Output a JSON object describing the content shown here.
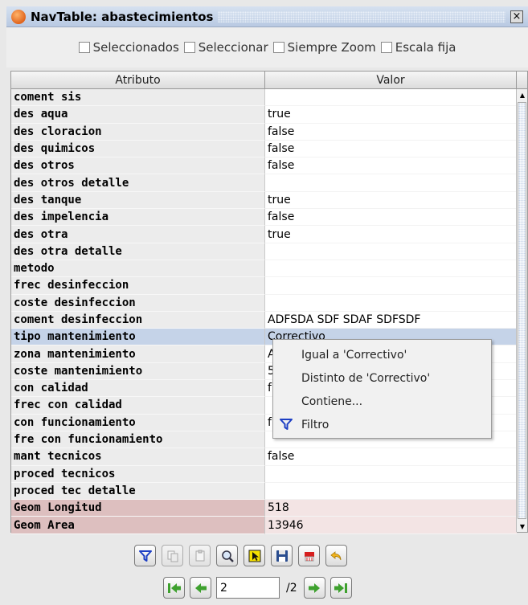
{
  "window": {
    "title": "NavTable: abastecimientos",
    "close_glyph": "×"
  },
  "options": {
    "seleccionados": "Seleccionados",
    "seleccionar": "Seleccionar",
    "siempre_zoom": "Siempre Zoom",
    "escala_fija": "Escala fija"
  },
  "table": {
    "headers": {
      "attr": "Atributo",
      "val": "Valor"
    },
    "rows": [
      {
        "attr": "coment sis",
        "val": ""
      },
      {
        "attr": "des aqua",
        "val": "true"
      },
      {
        "attr": "des cloracion",
        "val": "false"
      },
      {
        "attr": "des quimicos",
        "val": "false"
      },
      {
        "attr": "des otros",
        "val": "false"
      },
      {
        "attr": "des otros detalle",
        "val": ""
      },
      {
        "attr": "des tanque",
        "val": "true"
      },
      {
        "attr": "des impelencia",
        "val": "false"
      },
      {
        "attr": "des otra",
        "val": "true"
      },
      {
        "attr": "des otra detalle",
        "val": ""
      },
      {
        "attr": "metodo",
        "val": ""
      },
      {
        "attr": "frec desinfeccion",
        "val": ""
      },
      {
        "attr": "coste desinfeccion",
        "val": ""
      },
      {
        "attr": "coment desinfeccion",
        "val": "ADFSDA SDF SDAF SDFSDF"
      },
      {
        "attr": "tipo mantenimiento",
        "val": "Correctivo",
        "selected": true
      },
      {
        "attr": "zona mantenimiento",
        "val": "A"
      },
      {
        "attr": "coste mantenimiento",
        "val": "5"
      },
      {
        "attr": "con calidad",
        "val": "f"
      },
      {
        "attr": "frec con calidad",
        "val": ""
      },
      {
        "attr": "con funcionamiento",
        "val": "f"
      },
      {
        "attr": "fre con funcionamiento",
        "val": ""
      },
      {
        "attr": "mant tecnicos",
        "val": "false"
      },
      {
        "attr": "proced tecnicos",
        "val": ""
      },
      {
        "attr": "proced tec detalle",
        "val": ""
      },
      {
        "attr": "Geom Longitud",
        "val": "518",
        "geom": true
      },
      {
        "attr": "Geom Area",
        "val": "13946",
        "geom": true
      }
    ]
  },
  "context_menu": {
    "items": [
      "Igual a 'Correctivo'",
      "Distinto de 'Correctivo'",
      "Contiene...",
      "Filtro"
    ]
  },
  "navigation": {
    "current_page": "2",
    "total": "/2"
  },
  "icons": [
    "filter-icon",
    "copy-icon",
    "paste-icon",
    "zoom-icon",
    "select-icon",
    "save-icon",
    "delete-icon",
    "undo-icon",
    "first-icon",
    "previous-icon",
    "next-icon",
    "last-icon"
  ],
  "colors": {
    "selected_row": "#c5d3e8",
    "geom_attr": "#ddbfbf",
    "geom_val": "#f3e4e4",
    "filter_blue": "#1d3fc4"
  }
}
